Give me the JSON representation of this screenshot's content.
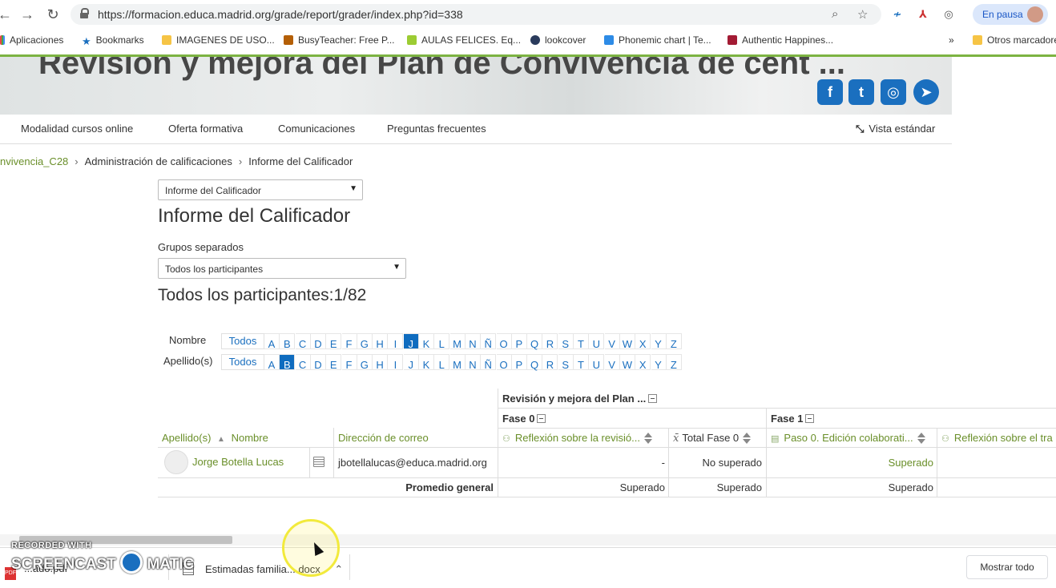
{
  "browser": {
    "url": "https://formacion.educa.madrid.org/grade/report/grader/index.php?id=338",
    "pause_label": "En pausa",
    "bookmarks": [
      "Aplicaciones",
      "Bookmarks",
      "IMAGENES DE USO...",
      "BusyTeacher: Free P...",
      "AULAS FELICES. Eq...",
      "lookcover",
      "Phonemic chart | Te...",
      "Authentic Happines...",
      "Otros marcadores"
    ]
  },
  "header": {
    "course_title": "Revisión y mejora del Plan de Convivencia de cent ...",
    "social": [
      "f",
      "t",
      "◎",
      "➤"
    ]
  },
  "nav": {
    "items": [
      "Modalidad cursos online",
      "Oferta formativa",
      "Comunicaciones",
      "Preguntas frecuentes"
    ],
    "standard_view": "Vista estándar"
  },
  "breadcrumb": {
    "course": "nvivencia_C28",
    "admin": "Administración de calificaciones",
    "current": "Informe del Calificador"
  },
  "report_select": "Informe del Calificador",
  "page_heading": "Informe del Calificador",
  "groups": {
    "label": "Grupos separados",
    "value": "Todos los participantes"
  },
  "participants_heading": "Todos los participantes:1/82",
  "initials": {
    "first_label": "Nombre",
    "last_label": "Apellido(s)",
    "all": "Todos",
    "letters": [
      "A",
      "B",
      "C",
      "D",
      "E",
      "F",
      "G",
      "H",
      "I",
      "J",
      "K",
      "L",
      "M",
      "N",
      "Ñ",
      "O",
      "P",
      "Q",
      "R",
      "S",
      "T",
      "U",
      "V",
      "W",
      "X",
      "Y",
      "Z"
    ],
    "first_selected": "J",
    "last_selected": "B"
  },
  "grader": {
    "category_top": "Revisión y mejora del Plan ...",
    "phase0": "Fase 0",
    "phase1": "Fase 1",
    "col_surname": "Apellido(s)",
    "col_name": "Nombre",
    "col_email": "Dirección de correo",
    "col_reflexion": "Reflexión sobre la revisió...",
    "col_total0": "Total Fase 0",
    "col_paso0": "Paso 0. Edición colaborati...",
    "col_reflexion2": "Reflexión sobre el tra",
    "student": {
      "name": "Jorge Botella Lucas",
      "email": "jbotellalucas@educa.madrid.org",
      "reflexion": "-",
      "total0": "No superado",
      "paso0": "Superado"
    },
    "average": {
      "label": "Promedio general",
      "reflexion": "Superado",
      "total0": "Superado",
      "paso0": "Superado"
    }
  },
  "downloads": {
    "file1": "...ado.pdf",
    "file2": "Estimadas familia....docx",
    "show_all": "Mostrar todo"
  },
  "watermark": {
    "line1": "RECORDED WITH",
    "line2": "SCREENCAST",
    "line3": "MATIC"
  }
}
